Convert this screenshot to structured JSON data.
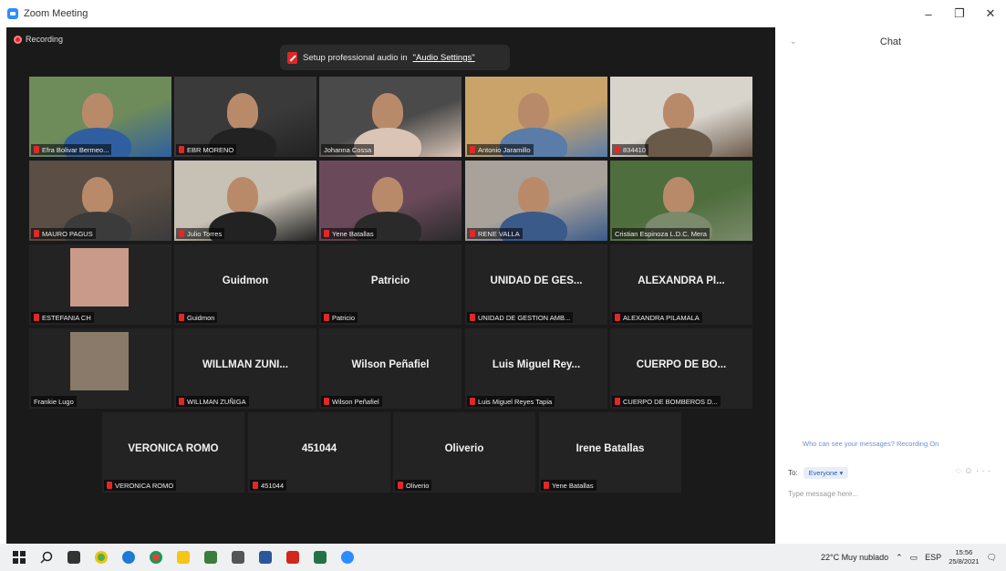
{
  "window": {
    "title": "Zoom Meeting",
    "controls": [
      "–",
      "❐",
      "✕"
    ]
  },
  "recording_label": "Recording",
  "audio_banner": {
    "text": "Setup professional audio in",
    "link": "\"Audio Settings\""
  },
  "participants": [
    {
      "name": "Efra Bolivar Bermeo...",
      "video": true,
      "muted": true
    },
    {
      "name": "EBR MORENO",
      "video": true,
      "muted": true
    },
    {
      "name": "Johanna Cossa",
      "video": true,
      "muted": false
    },
    {
      "name": "Antonio Jaramillo",
      "video": true,
      "muted": true
    },
    {
      "name": "834410",
      "video": true,
      "muted": true
    },
    {
      "name": "MAURO PAGUS",
      "video": true,
      "muted": true
    },
    {
      "name": "Julio Torres",
      "video": true,
      "muted": true
    },
    {
      "name": "Yene Batallas",
      "video": true,
      "muted": true
    },
    {
      "name": "RENE VALLA",
      "video": true,
      "muted": true
    },
    {
      "name": "Cristian Espinoza L.D.C. Mera",
      "video": true,
      "muted": false,
      "active_speaker": true
    },
    {
      "name": "ESTEFANIA CH",
      "video": true,
      "muted": true
    },
    {
      "display": "Guidmon",
      "name": "Guidmon",
      "video": false,
      "muted": true
    },
    {
      "display": "Patricio",
      "name": "Patricio",
      "video": false,
      "muted": true
    },
    {
      "display": "UNIDAD DE GES...",
      "name": "UNIDAD DE GESTION AMB...",
      "video": false,
      "muted": true
    },
    {
      "display": "ALEXANDRA PI...",
      "name": "ALEXANDRA PILAMALA",
      "video": false,
      "muted": true
    },
    {
      "name": "Frankie Lugo",
      "video": true,
      "muted": false
    },
    {
      "display": "WILLMAN ZUÑI...",
      "name": "WILLMAN ZUÑIGA",
      "video": false,
      "muted": true
    },
    {
      "display": "Wilson Peñafiel",
      "name": "Wilson Peñafiel",
      "video": false,
      "muted": true
    },
    {
      "display": "Luis Miguel Rey...",
      "name": "Luis Miguel Reyes Tapia",
      "video": false,
      "muted": true
    },
    {
      "display": "CUERPO DE BO...",
      "name": "CUERPO DE BOMBEROS D...",
      "video": false,
      "muted": true
    },
    {
      "display": "VERONICA ROMO",
      "name": "VERONICA ROMO",
      "video": false,
      "muted": true
    },
    {
      "display": "451044",
      "name": "451044",
      "video": false,
      "muted": true
    },
    {
      "display": "Oliverio",
      "name": "Oliverio",
      "video": false,
      "muted": true
    },
    {
      "display": "Irene Batallas",
      "name": "Yene Batallas",
      "video": false,
      "muted": true
    }
  ],
  "chat": {
    "title": "Chat",
    "who_can_see": "Who can see your messages? Recording On",
    "to_label": "To:",
    "recipient": "Everyone ▾",
    "input_placeholder": "Type message here..."
  },
  "taskbar": {
    "weather": "22°C  Muy nublado",
    "language": "ESP",
    "time": "15:56",
    "date": "25/8/2021"
  },
  "colors": {
    "meeting_bg": "#1a1a1a",
    "tile_bg": "#232323",
    "active_outline": "#a5d94a",
    "muted_red": "#e02828"
  }
}
